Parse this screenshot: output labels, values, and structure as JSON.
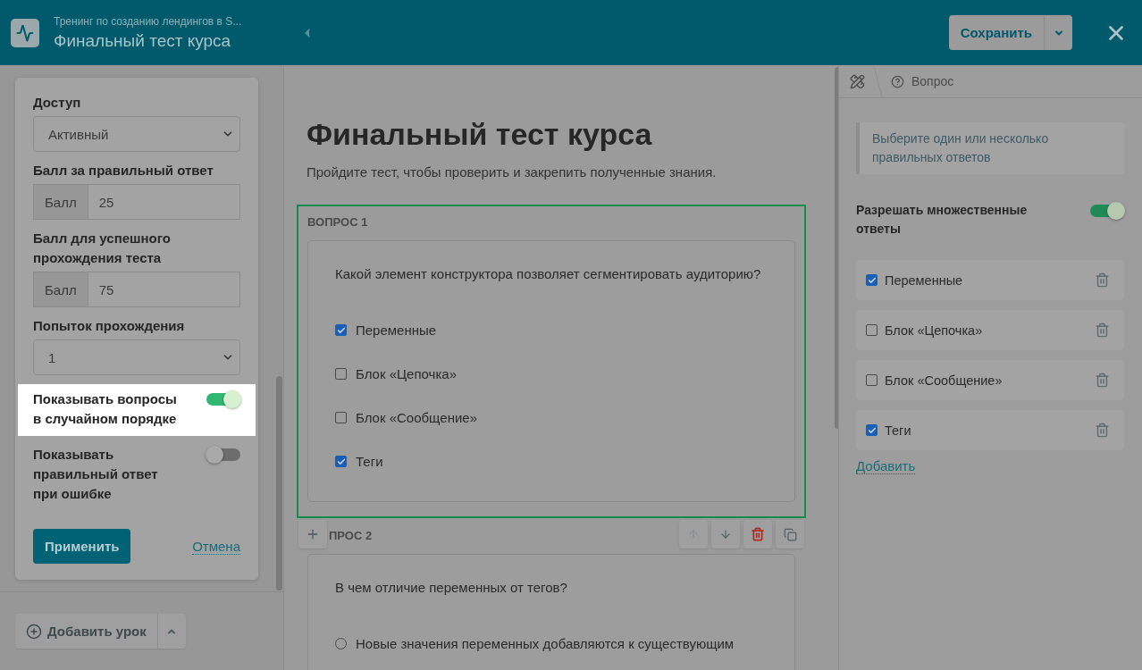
{
  "header": {
    "breadcrumb": "Тренинг по созданию лендингов в S...",
    "title": "Финальный тест курса",
    "save_button": "Сохранить"
  },
  "settings": {
    "fields": [
      {
        "kind": "select",
        "label": "Доступ",
        "value": "Активный"
      },
      {
        "kind": "addon",
        "label": "Балл за правильный ответ",
        "addon": "Балл",
        "value": "25"
      },
      {
        "kind": "addon",
        "label": "Балл для успешного прохождения теста",
        "addon": "Балл",
        "value": "75"
      },
      {
        "kind": "select",
        "label": "Попыток прохождения",
        "value": "1"
      },
      {
        "kind": "toggle",
        "label": "Показывать вопросы в случайном порядке",
        "on": true,
        "highlighted": true
      },
      {
        "kind": "toggle",
        "label": "Показывать правильный ответ при ошибке",
        "on": false,
        "highlighted": false
      }
    ],
    "apply_button": "Применить",
    "cancel_link": "Отмена"
  },
  "add_lesson_button": "Добавить урок",
  "test": {
    "title": "Финальный тест курса",
    "description": "Пройдите тест, чтобы проверить и закрепить полученные знания.",
    "questions": [
      {
        "label": "ВОПРОС 1",
        "selected": true,
        "text": "Какой элемент конструктора позволяет сегментировать аудиторию?",
        "answers": [
          {
            "kind": "checkbox",
            "text": "Переменные",
            "checked": true
          },
          {
            "kind": "checkbox",
            "text": "Блок «Цепочка»",
            "checked": false
          },
          {
            "kind": "checkbox",
            "text": "Блок «Сообщение»",
            "checked": false
          },
          {
            "kind": "checkbox",
            "text": "Теги",
            "checked": true
          }
        ]
      },
      {
        "label": "ПРОС 2",
        "selected": false,
        "text": "В чем отличие переменных от тегов?",
        "answers": [
          {
            "kind": "radio",
            "text": "Новые значения переменных добавляются к существующим",
            "checked": false
          }
        ]
      }
    ]
  },
  "inspector": {
    "breadcrumb": "Вопрос",
    "hint": "Выберите один или несколько правильных ответов",
    "multiple_toggle": {
      "label": "Разрешать множественные ответы",
      "on": true
    },
    "answers": [
      {
        "text": "Переменные",
        "checked": true
      },
      {
        "text": "Блок «Цепочка»",
        "checked": false
      },
      {
        "text": "Блок «Сообщение»",
        "checked": false
      },
      {
        "text": "Теги",
        "checked": true
      }
    ],
    "add_link": "Добавить"
  }
}
